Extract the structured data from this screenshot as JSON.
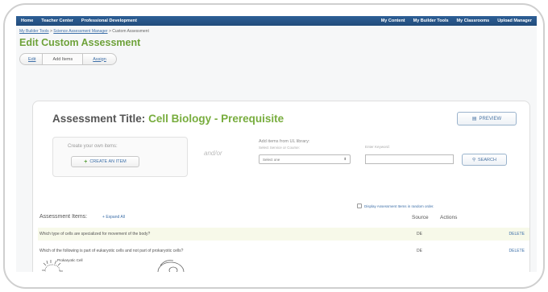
{
  "topnav": {
    "left": [
      "Home",
      "Teacher Center",
      "Professional Development"
    ],
    "right": [
      "My Content",
      "My Builder Tools",
      "My Classrooms",
      "Upload Manager"
    ]
  },
  "breadcrumb": {
    "crumbs": [
      "My Builder Tools",
      "Science Assessment Manager"
    ],
    "separator": ">",
    "current": "Custom Assessment"
  },
  "page": {
    "title": "Edit Custom Assessment"
  },
  "steps": [
    {
      "label": "Edit"
    },
    {
      "label": "Add Items"
    },
    {
      "label": "Assign"
    }
  ],
  "assessment": {
    "title_label": "Assessment Title:",
    "name": "Cell Biology - Prerequisite",
    "preview_label": "PREVIEW"
  },
  "create": {
    "label": "Create your own items:",
    "button": "CREATE AN ITEM"
  },
  "andor": "and/or",
  "library": {
    "label": "Add items from UL library:",
    "sublabel": "Select Service or Course:",
    "select_value": "Select one",
    "keyword_label": "Enter Keyword:",
    "search_label": "SEARCH"
  },
  "items": {
    "title": "Assessment Items:",
    "expand": "Expand All",
    "random_label": "Display Assessment Items in random order.",
    "col_source": "Source",
    "col_actions": "Actions",
    "rows": [
      {
        "question": "Which type of cells are specialized for movement of the body?",
        "source": "DE",
        "action": "DELETE"
      },
      {
        "question": "Which of the following is part of eukaryotic cells and not part of prokaryotic cells?",
        "source": "DE",
        "action": "DELETE"
      }
    ],
    "figure_label": "Prokaryotic Cell"
  },
  "colors": {
    "nav": "#2d5f96",
    "title_green": "#6ea23a",
    "link_blue": "#3d6fa8",
    "row_highlight": "#f7f9e9"
  }
}
